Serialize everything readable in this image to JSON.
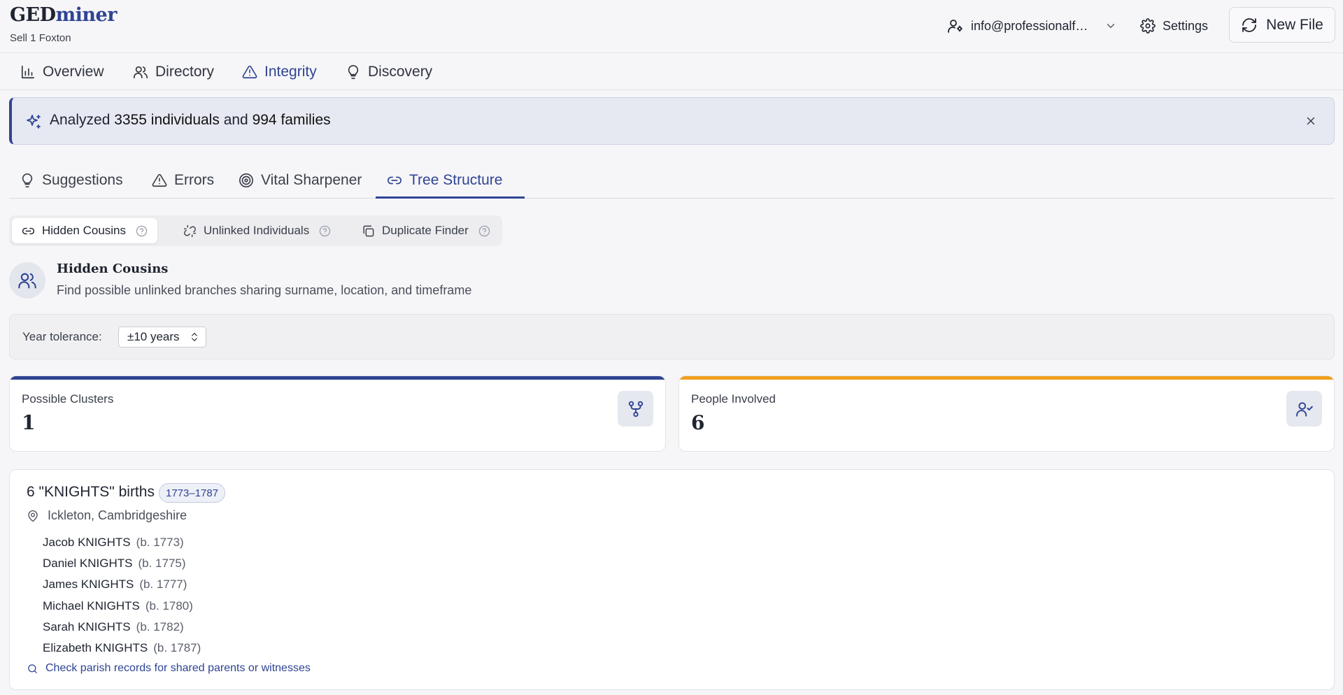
{
  "app": {
    "logo_part1": "GED",
    "logo_part2": "miner",
    "subtitle": "Sell 1 Foxton"
  },
  "header": {
    "account_label": "info@professionalf…",
    "settings_label": "Settings",
    "new_file_label": "New File"
  },
  "nav": {
    "items": [
      {
        "label": "Overview",
        "icon": "bar-chart-icon"
      },
      {
        "label": "Directory",
        "icon": "users-icon"
      },
      {
        "label": "Integrity",
        "icon": "warning-triangle-icon",
        "active": true
      },
      {
        "label": "Discovery",
        "icon": "lightbulb-icon"
      }
    ]
  },
  "banner": {
    "prefix": "Analyzed",
    "individuals": "3355 individuals",
    "middle": "and",
    "families": "994 families"
  },
  "subtabs": {
    "items": [
      {
        "label": "Suggestions",
        "icon": "lightbulb-icon"
      },
      {
        "label": "Errors",
        "icon": "warning-triangle-icon"
      },
      {
        "label": "Vital Sharpener",
        "icon": "target-icon"
      },
      {
        "label": "Tree Structure",
        "icon": "link-icon",
        "active": true
      }
    ]
  },
  "segments": {
    "items": [
      {
        "label": "Hidden Cousins",
        "icon": "link-icon",
        "active": true
      },
      {
        "label": "Unlinked Individuals",
        "icon": "unlink-icon"
      },
      {
        "label": "Duplicate Finder",
        "icon": "copy-icon"
      }
    ]
  },
  "section": {
    "title": "Hidden Cousins",
    "description": "Find possible unlinked branches sharing surname, location, and timeframe"
  },
  "tolerance": {
    "label": "Year tolerance:",
    "selected": "±10 years"
  },
  "stats": {
    "clusters_label": "Possible Clusters",
    "clusters_value": "1",
    "people_label": "People Involved",
    "people_value": "6",
    "accent_primary": "#2f4494",
    "accent_secondary": "#f0a020"
  },
  "cluster": {
    "title": "6 \"KNIGHTS\" births",
    "range": "1773–1787",
    "location": "Ickleton, Cambridgeshire",
    "people": [
      {
        "name": "Jacob KNIGHTS",
        "born": "(b. 1773)"
      },
      {
        "name": "Daniel KNIGHTS",
        "born": "(b. 1775)"
      },
      {
        "name": "James KNIGHTS",
        "born": "(b. 1777)"
      },
      {
        "name": "Michael KNIGHTS",
        "born": "(b. 1780)"
      },
      {
        "name": "Sarah KNIGHTS",
        "born": "(b. 1782)"
      },
      {
        "name": "Elizabeth KNIGHTS",
        "born": "(b. 1787)"
      }
    ],
    "tip": "Check parish records for shared parents or witnesses"
  }
}
